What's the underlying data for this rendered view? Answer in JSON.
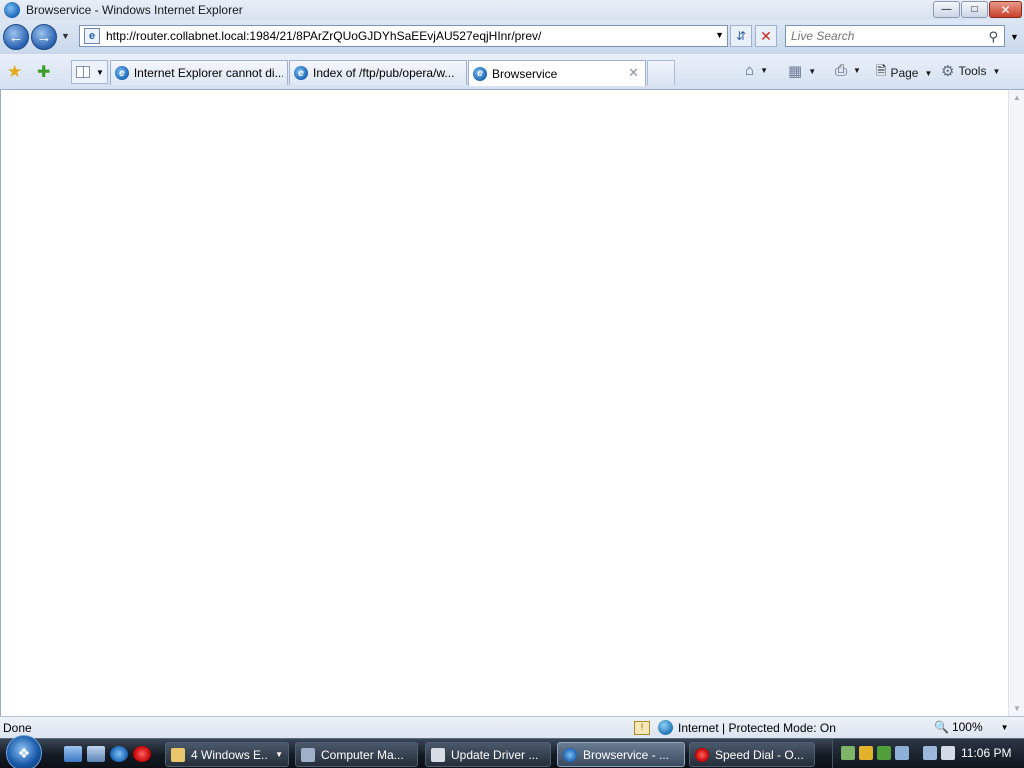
{
  "window": {
    "title": "Browservice - Windows Internet Explorer"
  },
  "nav": {
    "back_glyph": "←",
    "forward_glyph": "→",
    "address_url": "http://router.collabnet.local:1984/21/8PArZrQUoGJDYhSaEEvjAU527eqjHInr/prev/",
    "search_placeholder": "Live Search"
  },
  "tabs": [
    {
      "label": "Internet Explorer cannot di..."
    },
    {
      "label": "Index of /ftp/pub/opera/w..."
    },
    {
      "label": "Browservice"
    }
  ],
  "command_bar": {
    "page_label": "Page",
    "tools_label": "Tools"
  },
  "status": {
    "text": "Done",
    "zone": "Internet | Protected Mode: On",
    "zoom": "100%"
  },
  "taskbar": {
    "items": [
      {
        "label": "4 Windows E..."
      },
      {
        "label": "Computer Ma..."
      },
      {
        "label": "Update Driver ..."
      },
      {
        "label": "Browservice - ..."
      },
      {
        "label": "Speed Dial - O..."
      }
    ],
    "clock": "11:06 PM"
  },
  "colors": {
    "chrome_blue": "#d5e1f1",
    "taskbar_dark": "#141a22",
    "close_red": "#c8402a"
  }
}
